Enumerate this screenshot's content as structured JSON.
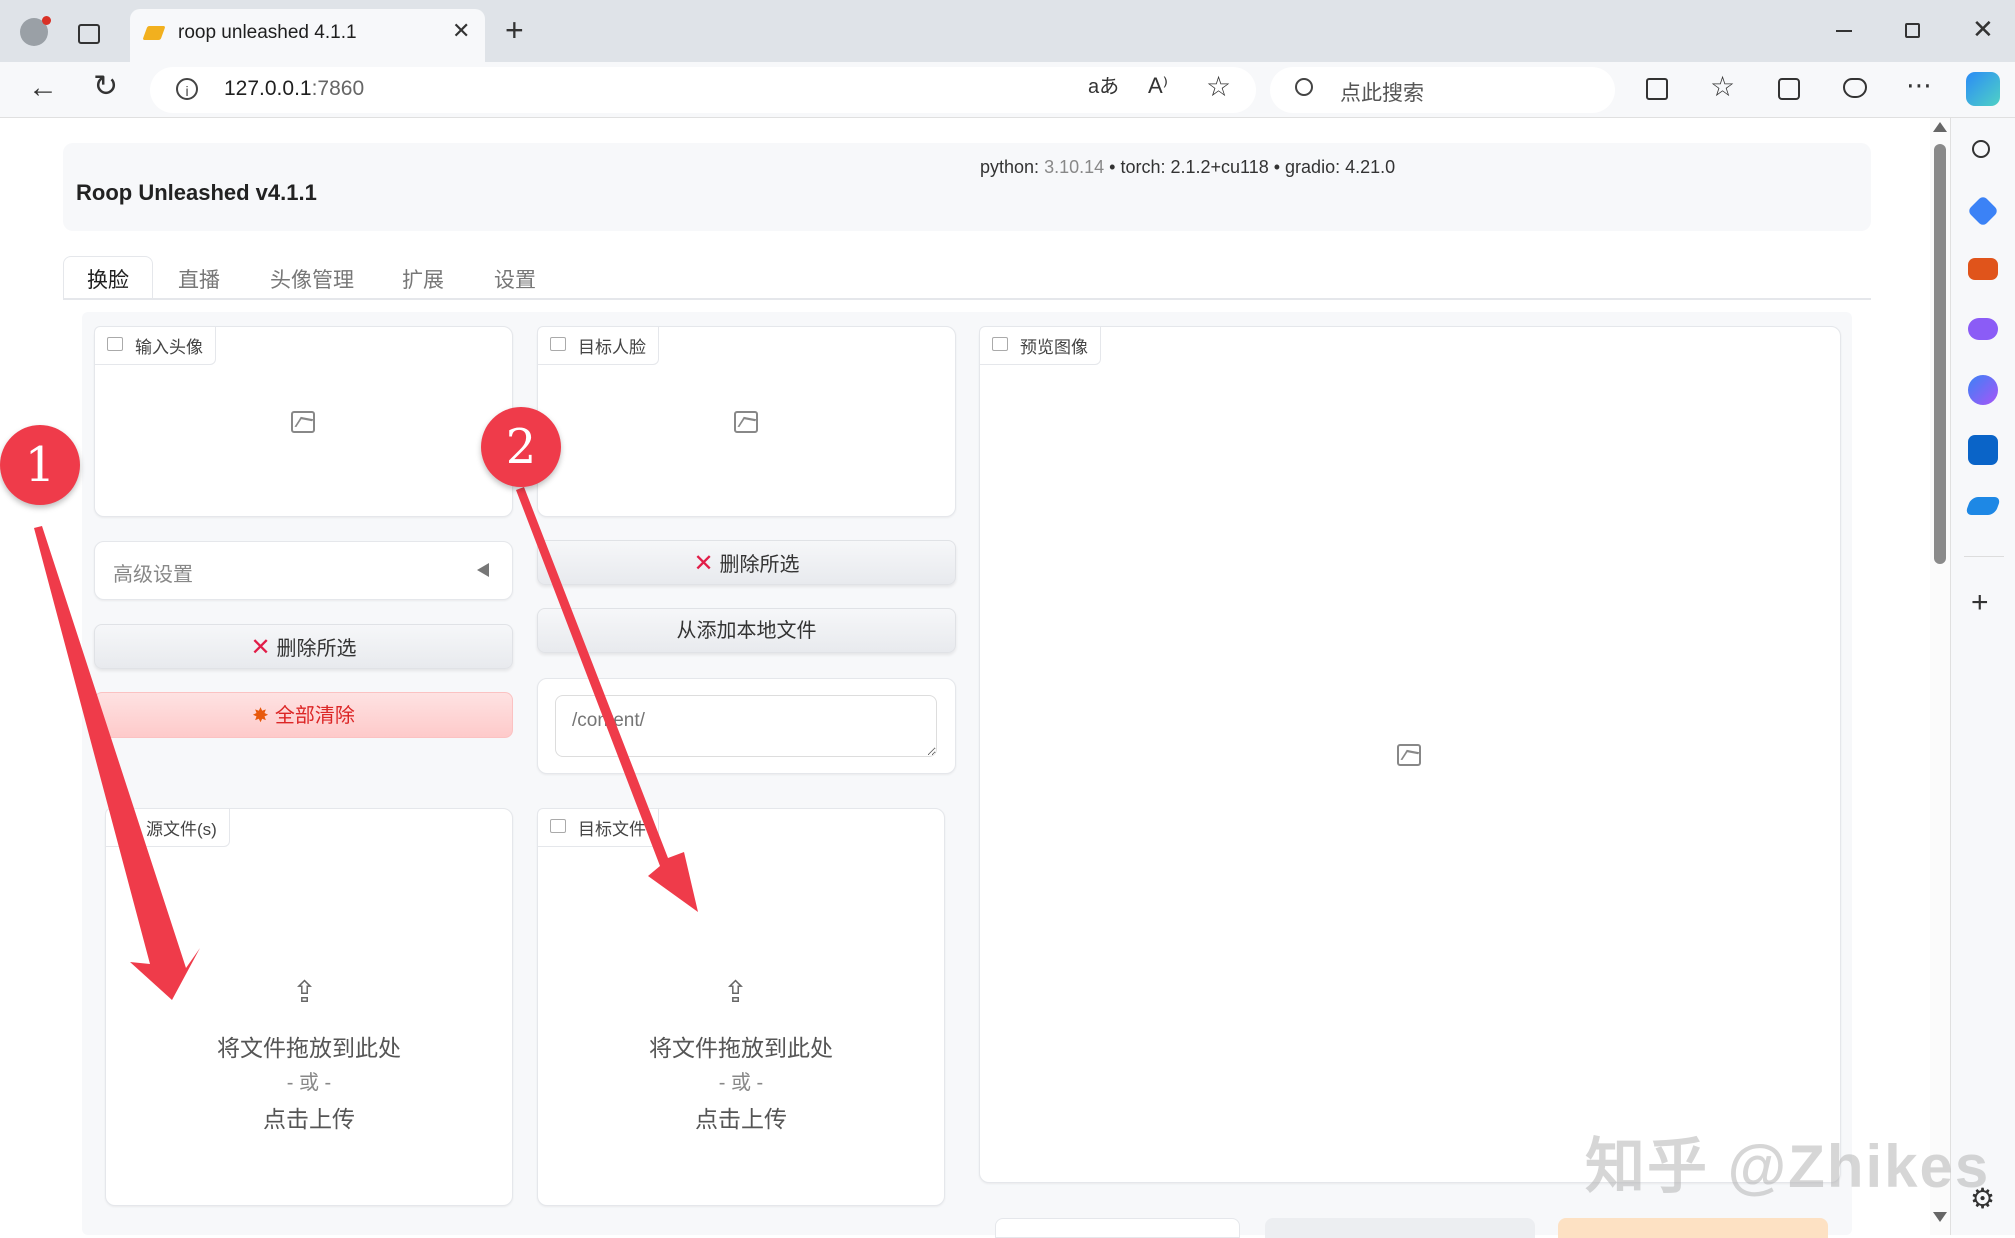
{
  "browser": {
    "tab_title": "roop unleashed 4.1.1",
    "tab_close": "✕",
    "new_tab": "+",
    "url_host": "127.0.0.1",
    "url_port": ":7860",
    "search_placeholder": "点此搜索"
  },
  "app": {
    "title": "Roop Unleashed v4.1.1",
    "python_label": "python:",
    "python_version": "3.10.14",
    "torch": "• torch: 2.1.2+cu118",
    "gradio": "• gradio: 4.21.0"
  },
  "tabs": [
    "换脸",
    "直播",
    "头像管理",
    "扩展",
    "设置"
  ],
  "left_column": {
    "input_face_label": "输入头像",
    "advanced_settings": "高级设置",
    "delete_selected": "删除所选",
    "clear_all": "全部清除",
    "source_files_label": "源文件(s)"
  },
  "middle_column": {
    "target_face_label": "目标人脸",
    "delete_selected": "删除所选",
    "add_local_files": "从添加本地文件",
    "path_placeholder": "/content/",
    "target_files_label": "目标文件"
  },
  "right_column": {
    "preview_label": "预览图像"
  },
  "upload": {
    "drop_text": "将文件拖放到此处",
    "or_text": "- 或 -",
    "click_text": "点击上传"
  },
  "annotations": {
    "badge1": "1",
    "badge2": "2",
    "arrow_color": "#ef3b4a"
  },
  "watermark": "知乎 @Zhikes"
}
